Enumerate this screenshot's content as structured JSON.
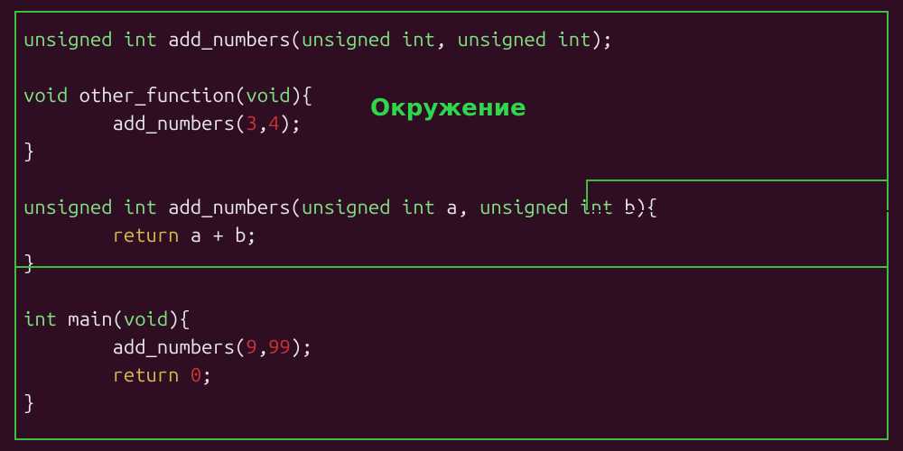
{
  "annotation": "Окружение",
  "code_lines": [
    [
      {
        "cls": "kw-type",
        "t": "unsigned int"
      },
      {
        "cls": "ident",
        "t": " add_numbers("
      },
      {
        "cls": "kw-type",
        "t": "unsigned int"
      },
      {
        "cls": "punct",
        "t": ", "
      },
      {
        "cls": "kw-type",
        "t": "unsigned int"
      },
      {
        "cls": "punct",
        "t": ");"
      }
    ],
    [],
    [
      {
        "cls": "kw-type",
        "t": "void"
      },
      {
        "cls": "ident",
        "t": " other_function("
      },
      {
        "cls": "kw-type",
        "t": "void"
      },
      {
        "cls": "punct",
        "t": "){"
      }
    ],
    [
      {
        "cls": "ident",
        "t": "        add_numbers("
      },
      {
        "cls": "num",
        "t": "3"
      },
      {
        "cls": "punct",
        "t": ","
      },
      {
        "cls": "num",
        "t": "4"
      },
      {
        "cls": "punct",
        "t": ");"
      }
    ],
    [
      {
        "cls": "punct",
        "t": "}"
      }
    ],
    [],
    [
      {
        "cls": "kw-type",
        "t": "unsigned int"
      },
      {
        "cls": "ident",
        "t": " add_numbers("
      },
      {
        "cls": "kw-type",
        "t": "unsigned int"
      },
      {
        "cls": "ident",
        "t": " a, "
      },
      {
        "cls": "kw-type",
        "t": "unsigned int"
      },
      {
        "cls": "ident",
        "t": " b"
      },
      {
        "cls": "punct",
        "t": "){"
      }
    ],
    [
      {
        "cls": "ident",
        "t": "        "
      },
      {
        "cls": "kw-stmt",
        "t": "return"
      },
      {
        "cls": "ident",
        "t": " a + b;"
      }
    ],
    [
      {
        "cls": "punct",
        "t": "}"
      }
    ],
    [],
    [
      {
        "cls": "kw-type",
        "t": "int"
      },
      {
        "cls": "ident",
        "t": " main("
      },
      {
        "cls": "kw-type",
        "t": "void"
      },
      {
        "cls": "punct",
        "t": "){"
      }
    ],
    [
      {
        "cls": "ident",
        "t": "        add_numbers("
      },
      {
        "cls": "num",
        "t": "9"
      },
      {
        "cls": "punct",
        "t": ","
      },
      {
        "cls": "num",
        "t": "99"
      },
      {
        "cls": "punct",
        "t": ");"
      }
    ],
    [
      {
        "cls": "ident",
        "t": "        "
      },
      {
        "cls": "kw-stmt",
        "t": "return"
      },
      {
        "cls": "ident",
        "t": " "
      },
      {
        "cls": "num",
        "t": "0"
      },
      {
        "cls": "punct",
        "t": ";"
      }
    ],
    [
      {
        "cls": "punct",
        "t": "}"
      }
    ]
  ]
}
